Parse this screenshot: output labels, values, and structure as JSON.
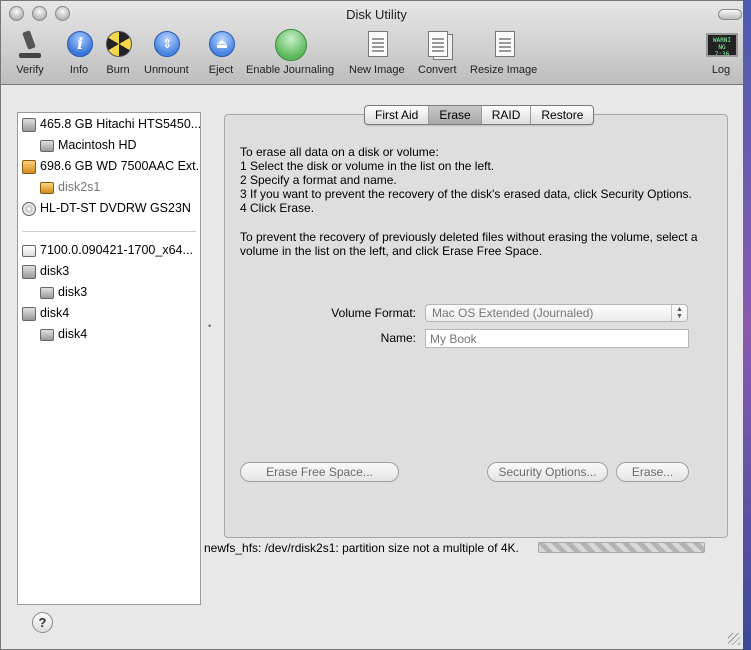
{
  "window": {
    "title": "Disk Utility"
  },
  "toolbar": {
    "verify": "Verify",
    "info": "Info",
    "burn": "Burn",
    "unmount": "Unmount",
    "eject": "Eject",
    "enable_journaling": "Enable Journaling",
    "new_image": "New Image",
    "convert": "Convert",
    "resize_image": "Resize Image",
    "log": "Log",
    "info_glyph": "i",
    "unmount_glyph": "⇕",
    "eject_glyph": "⏏",
    "log_screen_text": "WARNI\nNG 7:36"
  },
  "sidebar": {
    "items": [
      {
        "label": "465.8 GB Hitachi HTS5450...",
        "level": 0,
        "icon": "hard-drive-icon"
      },
      {
        "label": "Macintosh HD",
        "level": 1,
        "icon": "volume-icon"
      },
      {
        "label": "698.6 GB WD 7500AAC Ext...",
        "level": 0,
        "icon": "external-drive-icon"
      },
      {
        "label": "disk2s1",
        "level": 1,
        "icon": "external-volume-icon",
        "dimmed": true
      },
      {
        "label": "HL-DT-ST DVDRW GS23N",
        "level": 0,
        "icon": "optical-drive-icon"
      },
      {
        "label": "7100.0.090421-1700_x64...",
        "level": 0,
        "icon": "disk-image-icon"
      },
      {
        "label": "disk3",
        "level": 0,
        "icon": "disk-icon"
      },
      {
        "label": "disk3",
        "level": 1,
        "icon": "volume-icon"
      },
      {
        "label": "disk4",
        "level": 0,
        "icon": "disk-icon"
      },
      {
        "label": "disk4",
        "level": 1,
        "icon": "volume-icon"
      }
    ]
  },
  "tabs": [
    "First Aid",
    "Erase",
    "RAID",
    "Restore"
  ],
  "active_tab": "Erase",
  "erase": {
    "instructions": [
      "To erase all data on a disk or volume:",
      "1  Select the disk or volume in the list on the left.",
      "2  Specify a format and name.",
      "3  If you want to prevent the recovery of the disk's erased data, click Security Options.",
      "4  Click Erase."
    ],
    "instructions2": [
      "To prevent the recovery of previously deleted files without erasing the volume, select a",
      "volume in the list on the left, and click Erase Free Space."
    ],
    "volume_format_label": "Volume Format:",
    "volume_format_value": "Mac OS Extended (Journaled)",
    "name_label": "Name:",
    "name_placeholder": "My Book",
    "erase_free_space": "Erase Free Space...",
    "security_options": "Security Options...",
    "erase_button": "Erase..."
  },
  "status": {
    "message": "newfs_hfs: /dev/rdisk2s1: partition size not a multiple of 4K."
  },
  "help": {
    "glyph": "?"
  }
}
